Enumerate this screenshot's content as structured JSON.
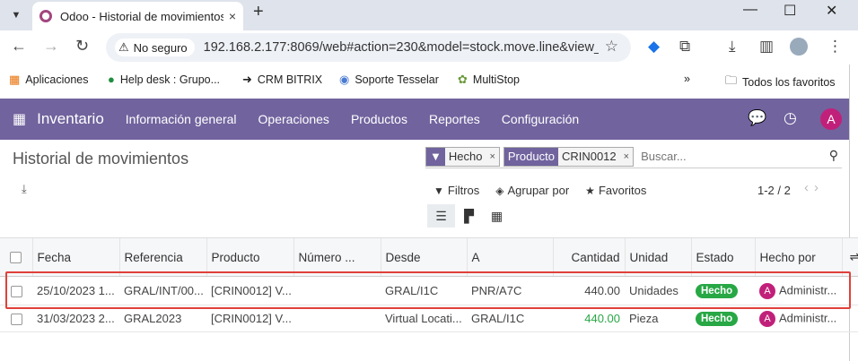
{
  "browser": {
    "tab_title": "Odoo - Historial de movimientos",
    "tab_close": "×",
    "new_tab": "+",
    "security_label": "No seguro",
    "url": "192.168.2.177:8069/web#action=230&model=stock.move.line&view_t..."
  },
  "bookmarks": [
    {
      "label": "Aplicaciones",
      "icon": "apps-grid-icon"
    },
    {
      "label": "Help desk : Grupo...",
      "icon": "helpdesk-icon"
    },
    {
      "label": "CRM BITRIX",
      "icon": "arrow-circle-icon"
    },
    {
      "label": "Soporte Tesselar",
      "icon": "support-icon"
    },
    {
      "label": "MultiStop",
      "icon": "multistop-icon"
    }
  ],
  "bookmarks_all": "Todos los favoritos",
  "navbar": {
    "brand": "Inventario",
    "menu": [
      "Información general",
      "Operaciones",
      "Productos",
      "Reportes",
      "Configuración"
    ],
    "avatar": "A"
  },
  "page": {
    "title": "Historial de movimientos",
    "facets": [
      {
        "head": "",
        "value": "Hecho"
      },
      {
        "head": "Producto",
        "value": "CRIN0012"
      }
    ],
    "search_placeholder": "Buscar...",
    "filters_label": "Filtros",
    "group_label": "Agrupar por",
    "favorites_label": "Favoritos",
    "pager": "1-2 / 2"
  },
  "table": {
    "columns": [
      "Fecha",
      "Referencia",
      "Producto",
      "Número ...",
      "Desde",
      "A",
      "Cantidad",
      "Unidad",
      "Estado",
      "Hecho por"
    ],
    "rows": [
      {
        "fecha": "25/10/2023 1...",
        "referencia": "GRAL/INT/00...",
        "producto": "[CRIN0012] V...",
        "numero": "",
        "desde": "GRAL/I1C",
        "a": "PNR/A7C",
        "cantidad": "440.00",
        "unidad": "Unidades",
        "estado": "Hecho",
        "avatar": "A",
        "hecho_por": "Administr..."
      },
      {
        "fecha": "31/03/2023 2...",
        "referencia": "GRAL2023",
        "producto": "[CRIN0012] V...",
        "numero": "",
        "desde": "Virtual Locati...",
        "a": "GRAL/I1C",
        "cantidad": "440.00",
        "unidad": "Pieza",
        "estado": "Hecho",
        "avatar": "A",
        "hecho_por": "Administr..."
      }
    ]
  },
  "colors": {
    "navbar": "#71639e",
    "success": "#28a745",
    "avatar": "#c1207a",
    "highlight": "#e0403a"
  }
}
